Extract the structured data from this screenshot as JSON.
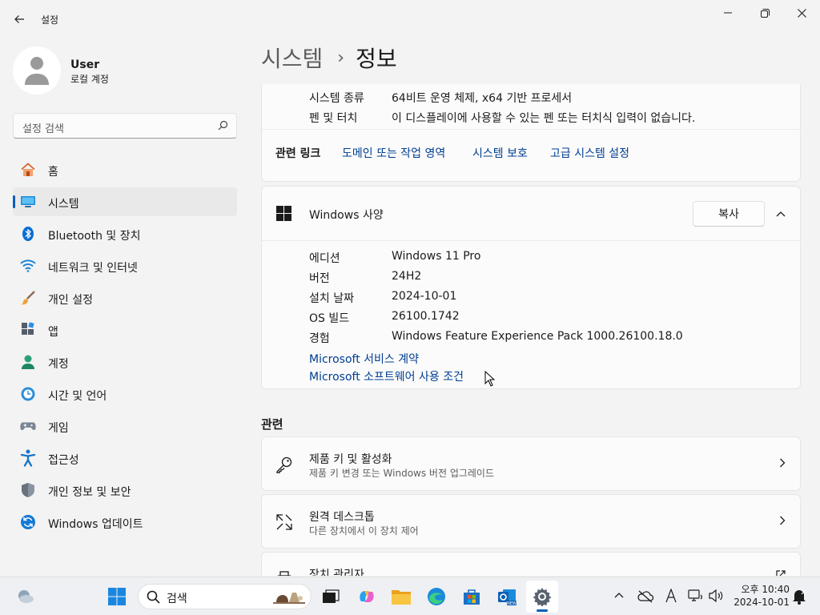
{
  "window": {
    "app_title": "설정"
  },
  "profile": {
    "name": "User",
    "account_type": "로컬 계정"
  },
  "search": {
    "placeholder": "설정 검색"
  },
  "nav": {
    "items": [
      {
        "label": "홈",
        "icon": "home-icon"
      },
      {
        "label": "시스템",
        "icon": "system-icon",
        "active": true
      },
      {
        "label": "Bluetooth 및 장치",
        "icon": "bluetooth-icon"
      },
      {
        "label": "네트워크 및 인터넷",
        "icon": "wifi-icon"
      },
      {
        "label": "개인 설정",
        "icon": "brush-icon"
      },
      {
        "label": "앱",
        "icon": "apps-icon"
      },
      {
        "label": "계정",
        "icon": "account-icon"
      },
      {
        "label": "시간 및 언어",
        "icon": "clock-globe-icon"
      },
      {
        "label": "게임",
        "icon": "gamepad-icon"
      },
      {
        "label": "접근성",
        "icon": "accessibility-icon"
      },
      {
        "label": "개인 정보 및 보안",
        "icon": "shield-icon"
      },
      {
        "label": "Windows 업데이트",
        "icon": "update-icon"
      }
    ]
  },
  "breadcrumb": {
    "parent": "시스템",
    "separator": "›",
    "current": "정보"
  },
  "device_specs_tail": [
    {
      "key": "시스템 종류",
      "value": "64비트 운영 체제, x64 기반 프로세서"
    },
    {
      "key": "펜 및 터치",
      "value": "이 디스플레이에 사용할 수 있는 펜 또는 터치식 입력이 없습니다."
    }
  ],
  "related_links": {
    "label": "관련 링크",
    "links": [
      "도메인 또는 작업 영역",
      "시스템 보호",
      "고급 시스템 설정"
    ]
  },
  "windows_spec": {
    "title": "Windows 사양",
    "copy_label": "복사",
    "rows": [
      {
        "key": "에디션",
        "value": "Windows 11 Pro"
      },
      {
        "key": "버전",
        "value": "24H2"
      },
      {
        "key": "설치 날짜",
        "value": "2024-10-01"
      },
      {
        "key": "OS 빌드",
        "value": "26100.1742"
      },
      {
        "key": "경험",
        "value": "Windows Feature Experience Pack 1000.26100.18.0"
      }
    ],
    "links": [
      "Microsoft 서비스 계약",
      "Microsoft 소프트웨어 사용 조건"
    ]
  },
  "related": {
    "title": "관련",
    "items": [
      {
        "title": "제품 키 및 활성화",
        "subtitle": "제품 키 변경 또는 Windows 버전 업그레이드",
        "icon": "key-icon"
      },
      {
        "title": "원격 데스크톱",
        "subtitle": "다른 장치에서 이 장치 제어",
        "icon": "remote-desktop-icon"
      },
      {
        "title": "장치 관리자",
        "subtitle": "",
        "icon": "printer-icon"
      }
    ]
  },
  "taskbar": {
    "search_label": "검색",
    "time": "오후 10:40",
    "date": "2024-10-01"
  },
  "colors": {
    "accent": "#005fb8",
    "link": "#003e92"
  }
}
